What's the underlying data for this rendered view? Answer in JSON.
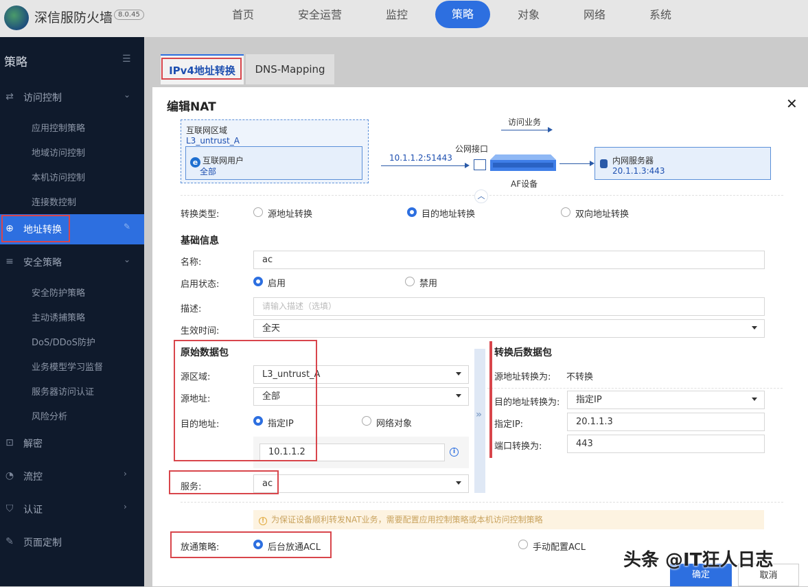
{
  "app": {
    "brand": "深信服防火墙",
    "version": "8.0.45"
  },
  "topnav": [
    "首页",
    "安全运营",
    "监控",
    "策略",
    "对象",
    "网络",
    "系统"
  ],
  "sidebar": {
    "title": "策略",
    "groups": [
      {
        "label": "访问控制",
        "icon": "access-control-icon"
      },
      {
        "label": "地址转换",
        "icon": "globe-icon"
      },
      {
        "label": "安全策略",
        "icon": "list-icon"
      },
      {
        "label": "解密",
        "icon": "lock-icon"
      },
      {
        "label": "流控",
        "icon": "flow-icon"
      },
      {
        "label": "认证",
        "icon": "shield-icon"
      },
      {
        "label": "页面定制",
        "icon": "edit-icon"
      }
    ],
    "access_items": [
      "应用控制策略",
      "地域访问控制",
      "本机访问控制",
      "连接数控制"
    ],
    "security_items": [
      "安全防护策略",
      "主动诱捕策略",
      "DoS/DDoS防护",
      "业务模型学习监督",
      "服务器访问认证",
      "风险分析"
    ]
  },
  "tabs": [
    "IPv4地址转换",
    "DNS-Mapping"
  ],
  "modal": {
    "title": "编辑NAT",
    "diagram": {
      "zone_title": "互联网区域",
      "zone_name": "L3_untrust_A",
      "user_label": "互联网用户",
      "user_value": "全部",
      "access_label": "访问业务",
      "public_iface": "公网接口",
      "public_addr": "10.1.1.2:51443",
      "device": "AF设备",
      "server_label": "内网服务器",
      "server_addr": "20.1.1.3:443"
    },
    "conv_type": {
      "label": "转换类型:",
      "options": [
        "源地址转换",
        "目的地址转换",
        "双向地址转换"
      ],
      "selected": "目的地址转换"
    },
    "basic_title": "基础信息",
    "name": {
      "label": "名称:",
      "value": "ac"
    },
    "status": {
      "label": "启用状态:",
      "options": [
        "启用",
        "禁用"
      ],
      "selected": "启用"
    },
    "desc": {
      "label": "描述:",
      "placeholder": "请输入描述（选填）"
    },
    "time": {
      "label": "生效时间:",
      "value": "全天"
    },
    "orig": {
      "title": "原始数据包",
      "src_zone": {
        "label": "源区域:",
        "value": "L3_untrust_A"
      },
      "src_addr": {
        "label": "源地址:",
        "value": "全部"
      },
      "dst_addr": {
        "label": "目的地址:",
        "options": [
          "指定IP",
          "网络对象"
        ],
        "selected": "指定IP",
        "ip": "10.1.1.2"
      },
      "service": {
        "label": "服务:",
        "value": "ac"
      }
    },
    "trans": {
      "title": "转换后数据包",
      "src_label": "源地址转换为:",
      "src_value": "不转换",
      "dst_label": "目的地址转换为:",
      "dst_value": "指定IP",
      "ip_label": "指定IP:",
      "ip_value": "20.1.1.3",
      "port_label": "端口转换为:",
      "port_value": "443"
    },
    "notice": "为保证设备顺利转发NAT业务，需要配置应用控制策略或本机访问控制策略",
    "policy": {
      "label": "放通策略:",
      "options": [
        "后台放通ACL",
        "手动配置ACL"
      ],
      "selected": "后台放通ACL"
    },
    "ok": "确定",
    "cancel": "取消"
  },
  "watermark": "头条 @IT狂人日志"
}
